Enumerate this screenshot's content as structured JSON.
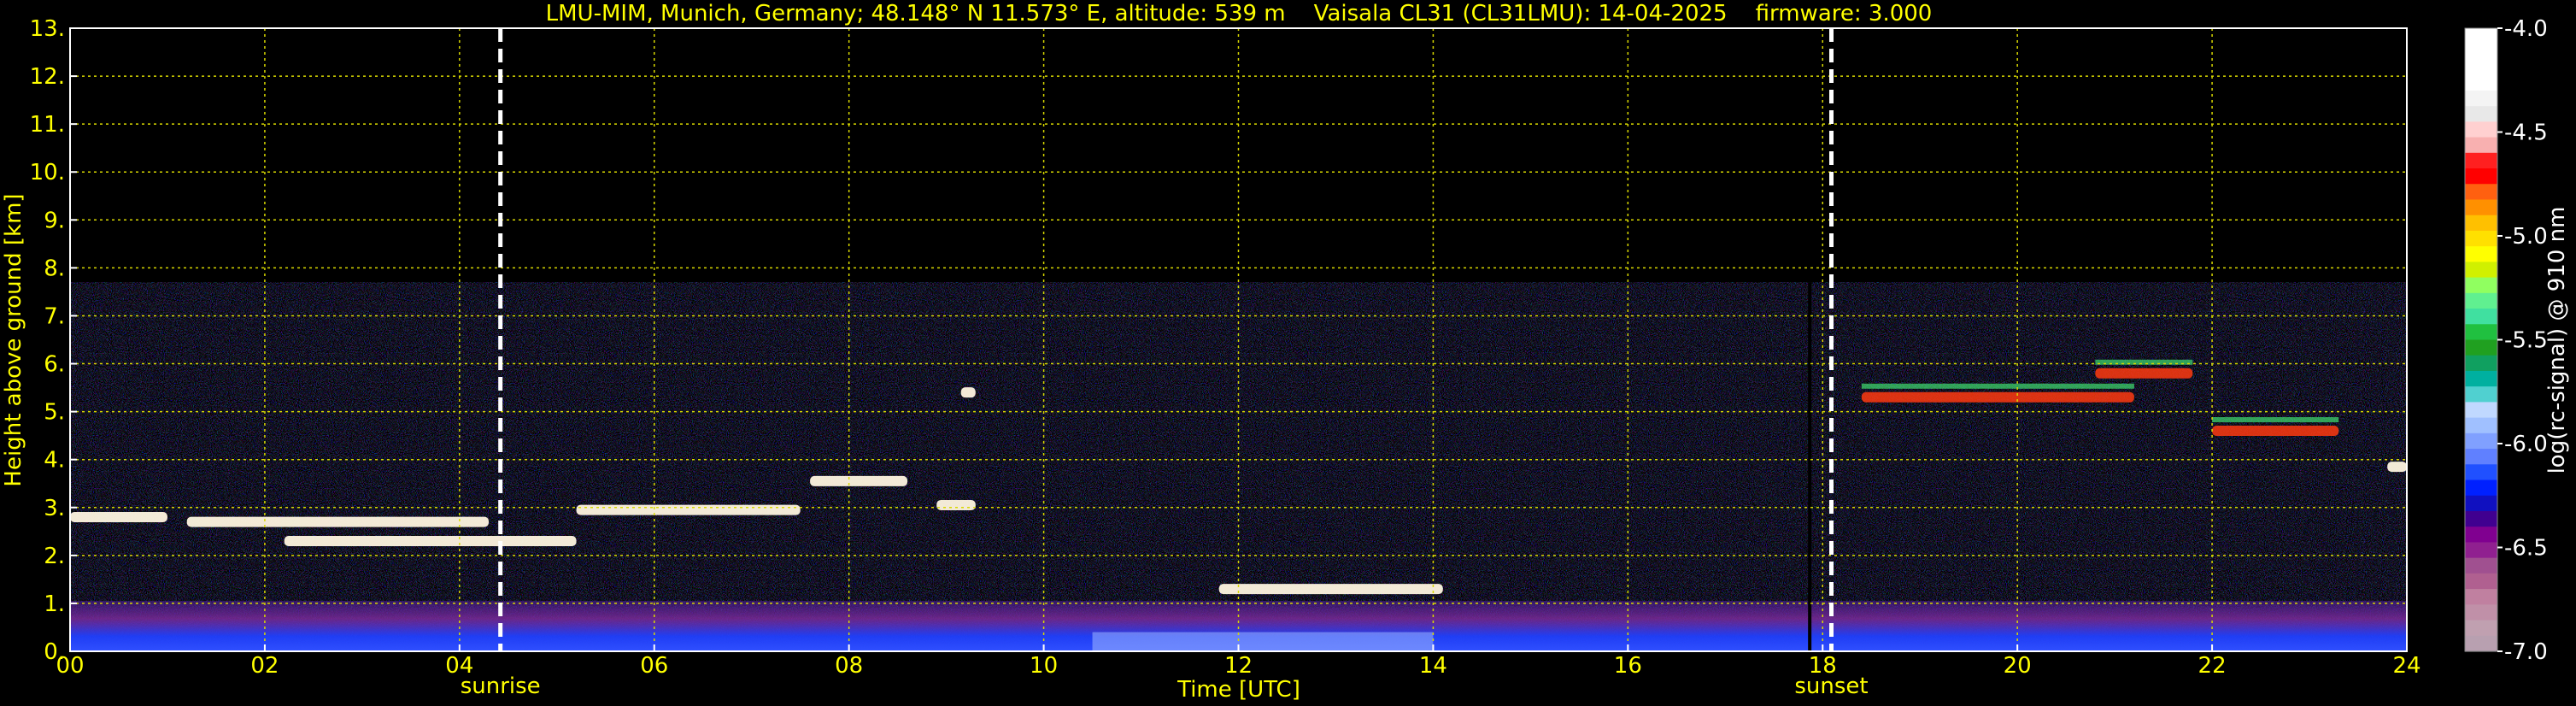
{
  "chart_data": {
    "type": "heatmap",
    "title": "LMU-MIM, Munich, Germany; 48.148° N 11.573° E, altitude: 539 m    Vaisala CL31 (CL31LMU): 14-04-2025    firmware: 3.000",
    "xlabel": "Time [UTC]",
    "ylabel": "Height above ground [km]",
    "xlim": [
      0,
      24
    ],
    "ylim": [
      0,
      13
    ],
    "x_ticks": [
      "00",
      "02",
      "04",
      "06",
      "08",
      "10",
      "12",
      "14",
      "16",
      "18",
      "20",
      "22",
      "24"
    ],
    "y_ticks": [
      "0.",
      "1.",
      "2.",
      "3.",
      "4.",
      "5.",
      "6.",
      "7.",
      "8.",
      "9.",
      "10.",
      "11.",
      "12.",
      "13."
    ],
    "grid": true,
    "markers": [
      {
        "label": "sunrise",
        "x": 4.42
      },
      {
        "label": "sunset",
        "x": 18.09
      }
    ],
    "signal_ceiling_km": 7.7,
    "layers": [
      {
        "x": [
          0.0,
          1.0
        ],
        "y": 2.8
      },
      {
        "x": [
          1.2,
          4.3
        ],
        "y": 2.7
      },
      {
        "x": [
          2.2,
          5.2
        ],
        "y": 2.3
      },
      {
        "x": [
          5.2,
          7.5
        ],
        "y": 2.95
      },
      {
        "x": [
          7.6,
          8.6
        ],
        "y": 3.55
      },
      {
        "x": [
          8.9,
          9.3
        ],
        "y": 3.05
      },
      {
        "x": [
          9.15,
          9.3
        ],
        "y": 5.4
      },
      {
        "x": [
          11.8,
          14.1
        ],
        "y": 1.3
      },
      {
        "x": [
          18.4,
          21.2
        ],
        "y": 5.3
      },
      {
        "x": [
          20.8,
          21.8
        ],
        "y": 5.8
      },
      {
        "x": [
          22.0,
          23.3
        ],
        "y": 4.6
      },
      {
        "x": [
          23.8,
          24.0
        ],
        "y": 3.85
      }
    ],
    "colorbar": {
      "label": "log(rc-signal) @ 910 nm",
      "ticks": [
        "-4.0",
        "-4.5",
        "-5.0",
        "-5.5",
        "-6.0",
        "-6.5",
        "-7.0"
      ],
      "range": [
        -7.0,
        -4.0
      ],
      "colors": [
        "#ffffff",
        "#ffffff",
        "#ffffff",
        "#ffffff",
        "#f4f4f4",
        "#e8e8e8",
        "#ffd0d0",
        "#f8b0b0",
        "#ff2020",
        "#ff0000",
        "#ff6010",
        "#ff9000",
        "#ffc000",
        "#ffe000",
        "#ffff00",
        "#d0f000",
        "#90ff60",
        "#60f090",
        "#40e0a0",
        "#20c040",
        "#20a020",
        "#10a060",
        "#00b0a0",
        "#50d0d0",
        "#c0d8ff",
        "#a0c0ff",
        "#80a0ff",
        "#6080ff",
        "#2050ff",
        "#0020ff",
        "#1010c0",
        "#400090",
        "#800090",
        "#902090",
        "#a05090",
        "#b06090",
        "#c080a0",
        "#c090a8",
        "#c0a0b0",
        "#b8a0b0"
      ]
    }
  }
}
